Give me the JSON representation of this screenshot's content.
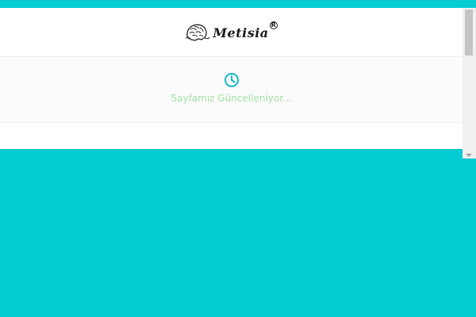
{
  "logo": {
    "text": "Metisia",
    "registered_mark": "R",
    "icon": "head-illustration-icon"
  },
  "maintenance": {
    "icon": "clock-icon",
    "message": "Sayfamız Güncelleniyor..."
  },
  "colors": {
    "background": "#06ccd4",
    "accent": "#11b8c4",
    "message": "#a4e0a3"
  }
}
